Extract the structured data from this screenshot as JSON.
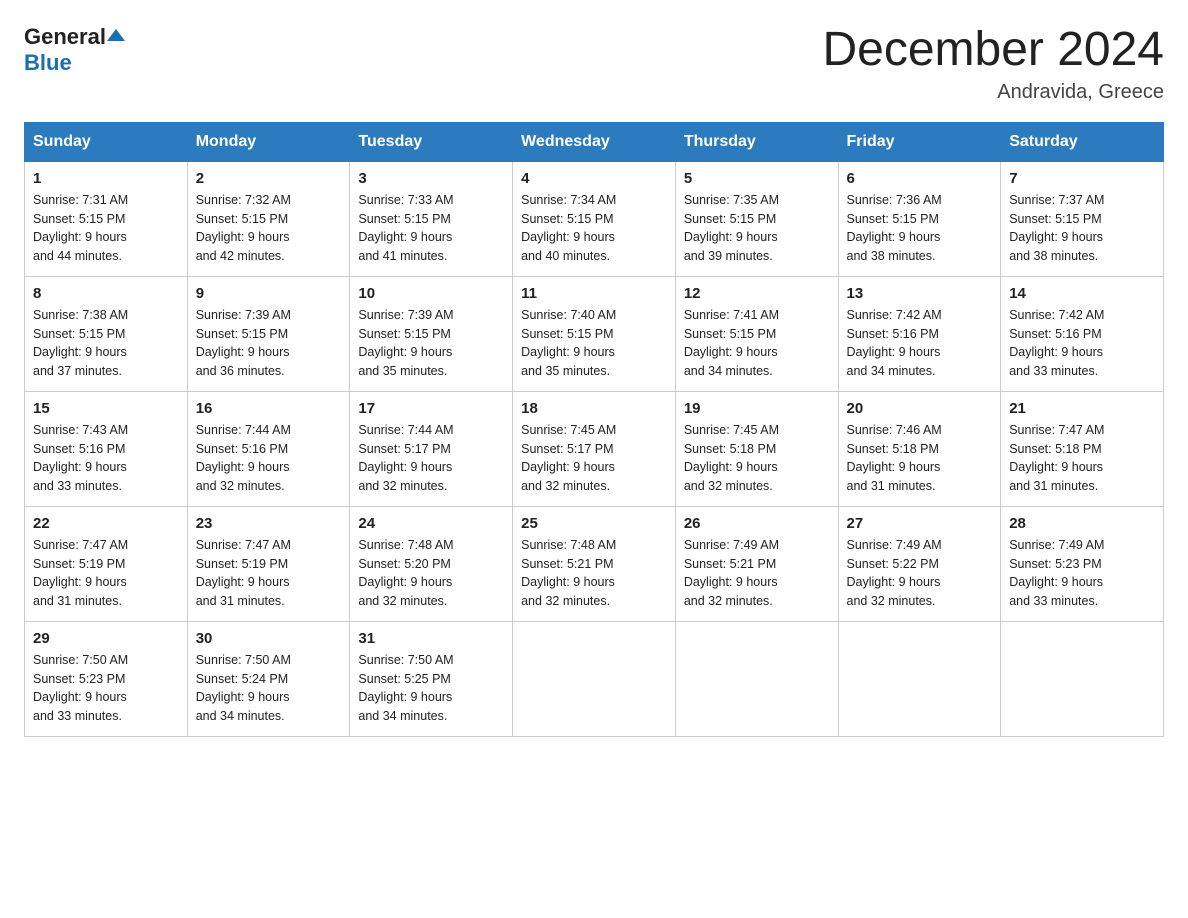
{
  "header": {
    "logo_general": "General",
    "logo_blue": "Blue",
    "month_title": "December 2024",
    "location": "Andravida, Greece"
  },
  "days_of_week": [
    "Sunday",
    "Monday",
    "Tuesday",
    "Wednesday",
    "Thursday",
    "Friday",
    "Saturday"
  ],
  "weeks": [
    [
      {
        "day": "1",
        "sunrise": "7:31 AM",
        "sunset": "5:15 PM",
        "daylight": "9 hours and 44 minutes."
      },
      {
        "day": "2",
        "sunrise": "7:32 AM",
        "sunset": "5:15 PM",
        "daylight": "9 hours and 42 minutes."
      },
      {
        "day": "3",
        "sunrise": "7:33 AM",
        "sunset": "5:15 PM",
        "daylight": "9 hours and 41 minutes."
      },
      {
        "day": "4",
        "sunrise": "7:34 AM",
        "sunset": "5:15 PM",
        "daylight": "9 hours and 40 minutes."
      },
      {
        "day": "5",
        "sunrise": "7:35 AM",
        "sunset": "5:15 PM",
        "daylight": "9 hours and 39 minutes."
      },
      {
        "day": "6",
        "sunrise": "7:36 AM",
        "sunset": "5:15 PM",
        "daylight": "9 hours and 38 minutes."
      },
      {
        "day": "7",
        "sunrise": "7:37 AM",
        "sunset": "5:15 PM",
        "daylight": "9 hours and 38 minutes."
      }
    ],
    [
      {
        "day": "8",
        "sunrise": "7:38 AM",
        "sunset": "5:15 PM",
        "daylight": "9 hours and 37 minutes."
      },
      {
        "day": "9",
        "sunrise": "7:39 AM",
        "sunset": "5:15 PM",
        "daylight": "9 hours and 36 minutes."
      },
      {
        "day": "10",
        "sunrise": "7:39 AM",
        "sunset": "5:15 PM",
        "daylight": "9 hours and 35 minutes."
      },
      {
        "day": "11",
        "sunrise": "7:40 AM",
        "sunset": "5:15 PM",
        "daylight": "9 hours and 35 minutes."
      },
      {
        "day": "12",
        "sunrise": "7:41 AM",
        "sunset": "5:15 PM",
        "daylight": "9 hours and 34 minutes."
      },
      {
        "day": "13",
        "sunrise": "7:42 AM",
        "sunset": "5:16 PM",
        "daylight": "9 hours and 34 minutes."
      },
      {
        "day": "14",
        "sunrise": "7:42 AM",
        "sunset": "5:16 PM",
        "daylight": "9 hours and 33 minutes."
      }
    ],
    [
      {
        "day": "15",
        "sunrise": "7:43 AM",
        "sunset": "5:16 PM",
        "daylight": "9 hours and 33 minutes."
      },
      {
        "day": "16",
        "sunrise": "7:44 AM",
        "sunset": "5:16 PM",
        "daylight": "9 hours and 32 minutes."
      },
      {
        "day": "17",
        "sunrise": "7:44 AM",
        "sunset": "5:17 PM",
        "daylight": "9 hours and 32 minutes."
      },
      {
        "day": "18",
        "sunrise": "7:45 AM",
        "sunset": "5:17 PM",
        "daylight": "9 hours and 32 minutes."
      },
      {
        "day": "19",
        "sunrise": "7:45 AM",
        "sunset": "5:18 PM",
        "daylight": "9 hours and 32 minutes."
      },
      {
        "day": "20",
        "sunrise": "7:46 AM",
        "sunset": "5:18 PM",
        "daylight": "9 hours and 31 minutes."
      },
      {
        "day": "21",
        "sunrise": "7:47 AM",
        "sunset": "5:18 PM",
        "daylight": "9 hours and 31 minutes."
      }
    ],
    [
      {
        "day": "22",
        "sunrise": "7:47 AM",
        "sunset": "5:19 PM",
        "daylight": "9 hours and 31 minutes."
      },
      {
        "day": "23",
        "sunrise": "7:47 AM",
        "sunset": "5:19 PM",
        "daylight": "9 hours and 31 minutes."
      },
      {
        "day": "24",
        "sunrise": "7:48 AM",
        "sunset": "5:20 PM",
        "daylight": "9 hours and 32 minutes."
      },
      {
        "day": "25",
        "sunrise": "7:48 AM",
        "sunset": "5:21 PM",
        "daylight": "9 hours and 32 minutes."
      },
      {
        "day": "26",
        "sunrise": "7:49 AM",
        "sunset": "5:21 PM",
        "daylight": "9 hours and 32 minutes."
      },
      {
        "day": "27",
        "sunrise": "7:49 AM",
        "sunset": "5:22 PM",
        "daylight": "9 hours and 32 minutes."
      },
      {
        "day": "28",
        "sunrise": "7:49 AM",
        "sunset": "5:23 PM",
        "daylight": "9 hours and 33 minutes."
      }
    ],
    [
      {
        "day": "29",
        "sunrise": "7:50 AM",
        "sunset": "5:23 PM",
        "daylight": "9 hours and 33 minutes."
      },
      {
        "day": "30",
        "sunrise": "7:50 AM",
        "sunset": "5:24 PM",
        "daylight": "9 hours and 34 minutes."
      },
      {
        "day": "31",
        "sunrise": "7:50 AM",
        "sunset": "5:25 PM",
        "daylight": "9 hours and 34 minutes."
      },
      null,
      null,
      null,
      null
    ]
  ],
  "labels": {
    "sunrise": "Sunrise:",
    "sunset": "Sunset:",
    "daylight": "Daylight:"
  }
}
